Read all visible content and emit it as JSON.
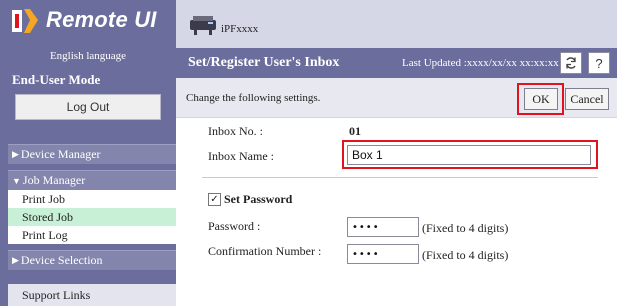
{
  "app": {
    "logo_text": "Remote UI",
    "language": "English language",
    "mode": "End-User Mode",
    "logout_label": "Log Out"
  },
  "sidebar": {
    "device_manager": "Device Manager",
    "job_manager": "Job Manager",
    "job_items": [
      "Print Job",
      "Stored Job",
      "Print Log"
    ],
    "active_item": "Stored Job",
    "device_selection": "Device Selection",
    "support_links": "Support Links"
  },
  "header": {
    "printer_name": "iPFxxxx",
    "page_title": "Set/Register User's Inbox",
    "last_updated": "Last Updated :xxxx/xx/xx xx:xx:xx",
    "refresh_icon": "refresh-icon",
    "help_label": "?"
  },
  "instructions": {
    "text": "Change the following settings.",
    "ok_label": "OK",
    "cancel_label": "Cancel"
  },
  "form": {
    "inbox_no_label": "Inbox No. :",
    "inbox_no_value": "01",
    "inbox_name_label": "Inbox Name :",
    "inbox_name_value": "Box 1",
    "set_password_label": "Set Password",
    "set_password_checked": true,
    "password_label": "Password :",
    "password_value": "••••",
    "password_note": "(Fixed to 4 digits)",
    "confirmation_label": "Confirmation Number :",
    "confirmation_value": "••••",
    "confirmation_note": "(Fixed to 4 digits)"
  },
  "colors": {
    "sidebar_bg": "#6b6d9c",
    "header_bg": "#d6d7e6",
    "active_item_bg": "#c7f0d6",
    "highlight_red": "#e0141e"
  }
}
